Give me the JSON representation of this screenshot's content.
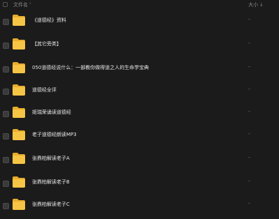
{
  "header": {
    "name_label": "文件名",
    "size_label": "大小",
    "sort_arrow": "↓",
    "name_chevron": "˅"
  },
  "files": [
    {
      "name": "《道德经》资料",
      "size": "-"
    },
    {
      "name": "【其它旁类】",
      "size": "-"
    },
    {
      "name": "050道德经说什么：一部教你做得道之人的生命学宝典",
      "size": "-"
    },
    {
      "name": "道德经全评",
      "size": "-"
    },
    {
      "name": "姬瑞荣诵读道德经",
      "size": "-"
    },
    {
      "name": "老子道德经朗读MP3",
      "size": "-"
    },
    {
      "name": "张鼎柏解读老子A",
      "size": "-"
    },
    {
      "name": "张鼎柏解读老子B",
      "size": "-"
    },
    {
      "name": "张鼎柏解读老子C",
      "size": "-"
    }
  ],
  "colors": {
    "background": "#1b1b1b",
    "folder_yellow": "#f6c545",
    "folder_back": "#e9ad2c"
  }
}
